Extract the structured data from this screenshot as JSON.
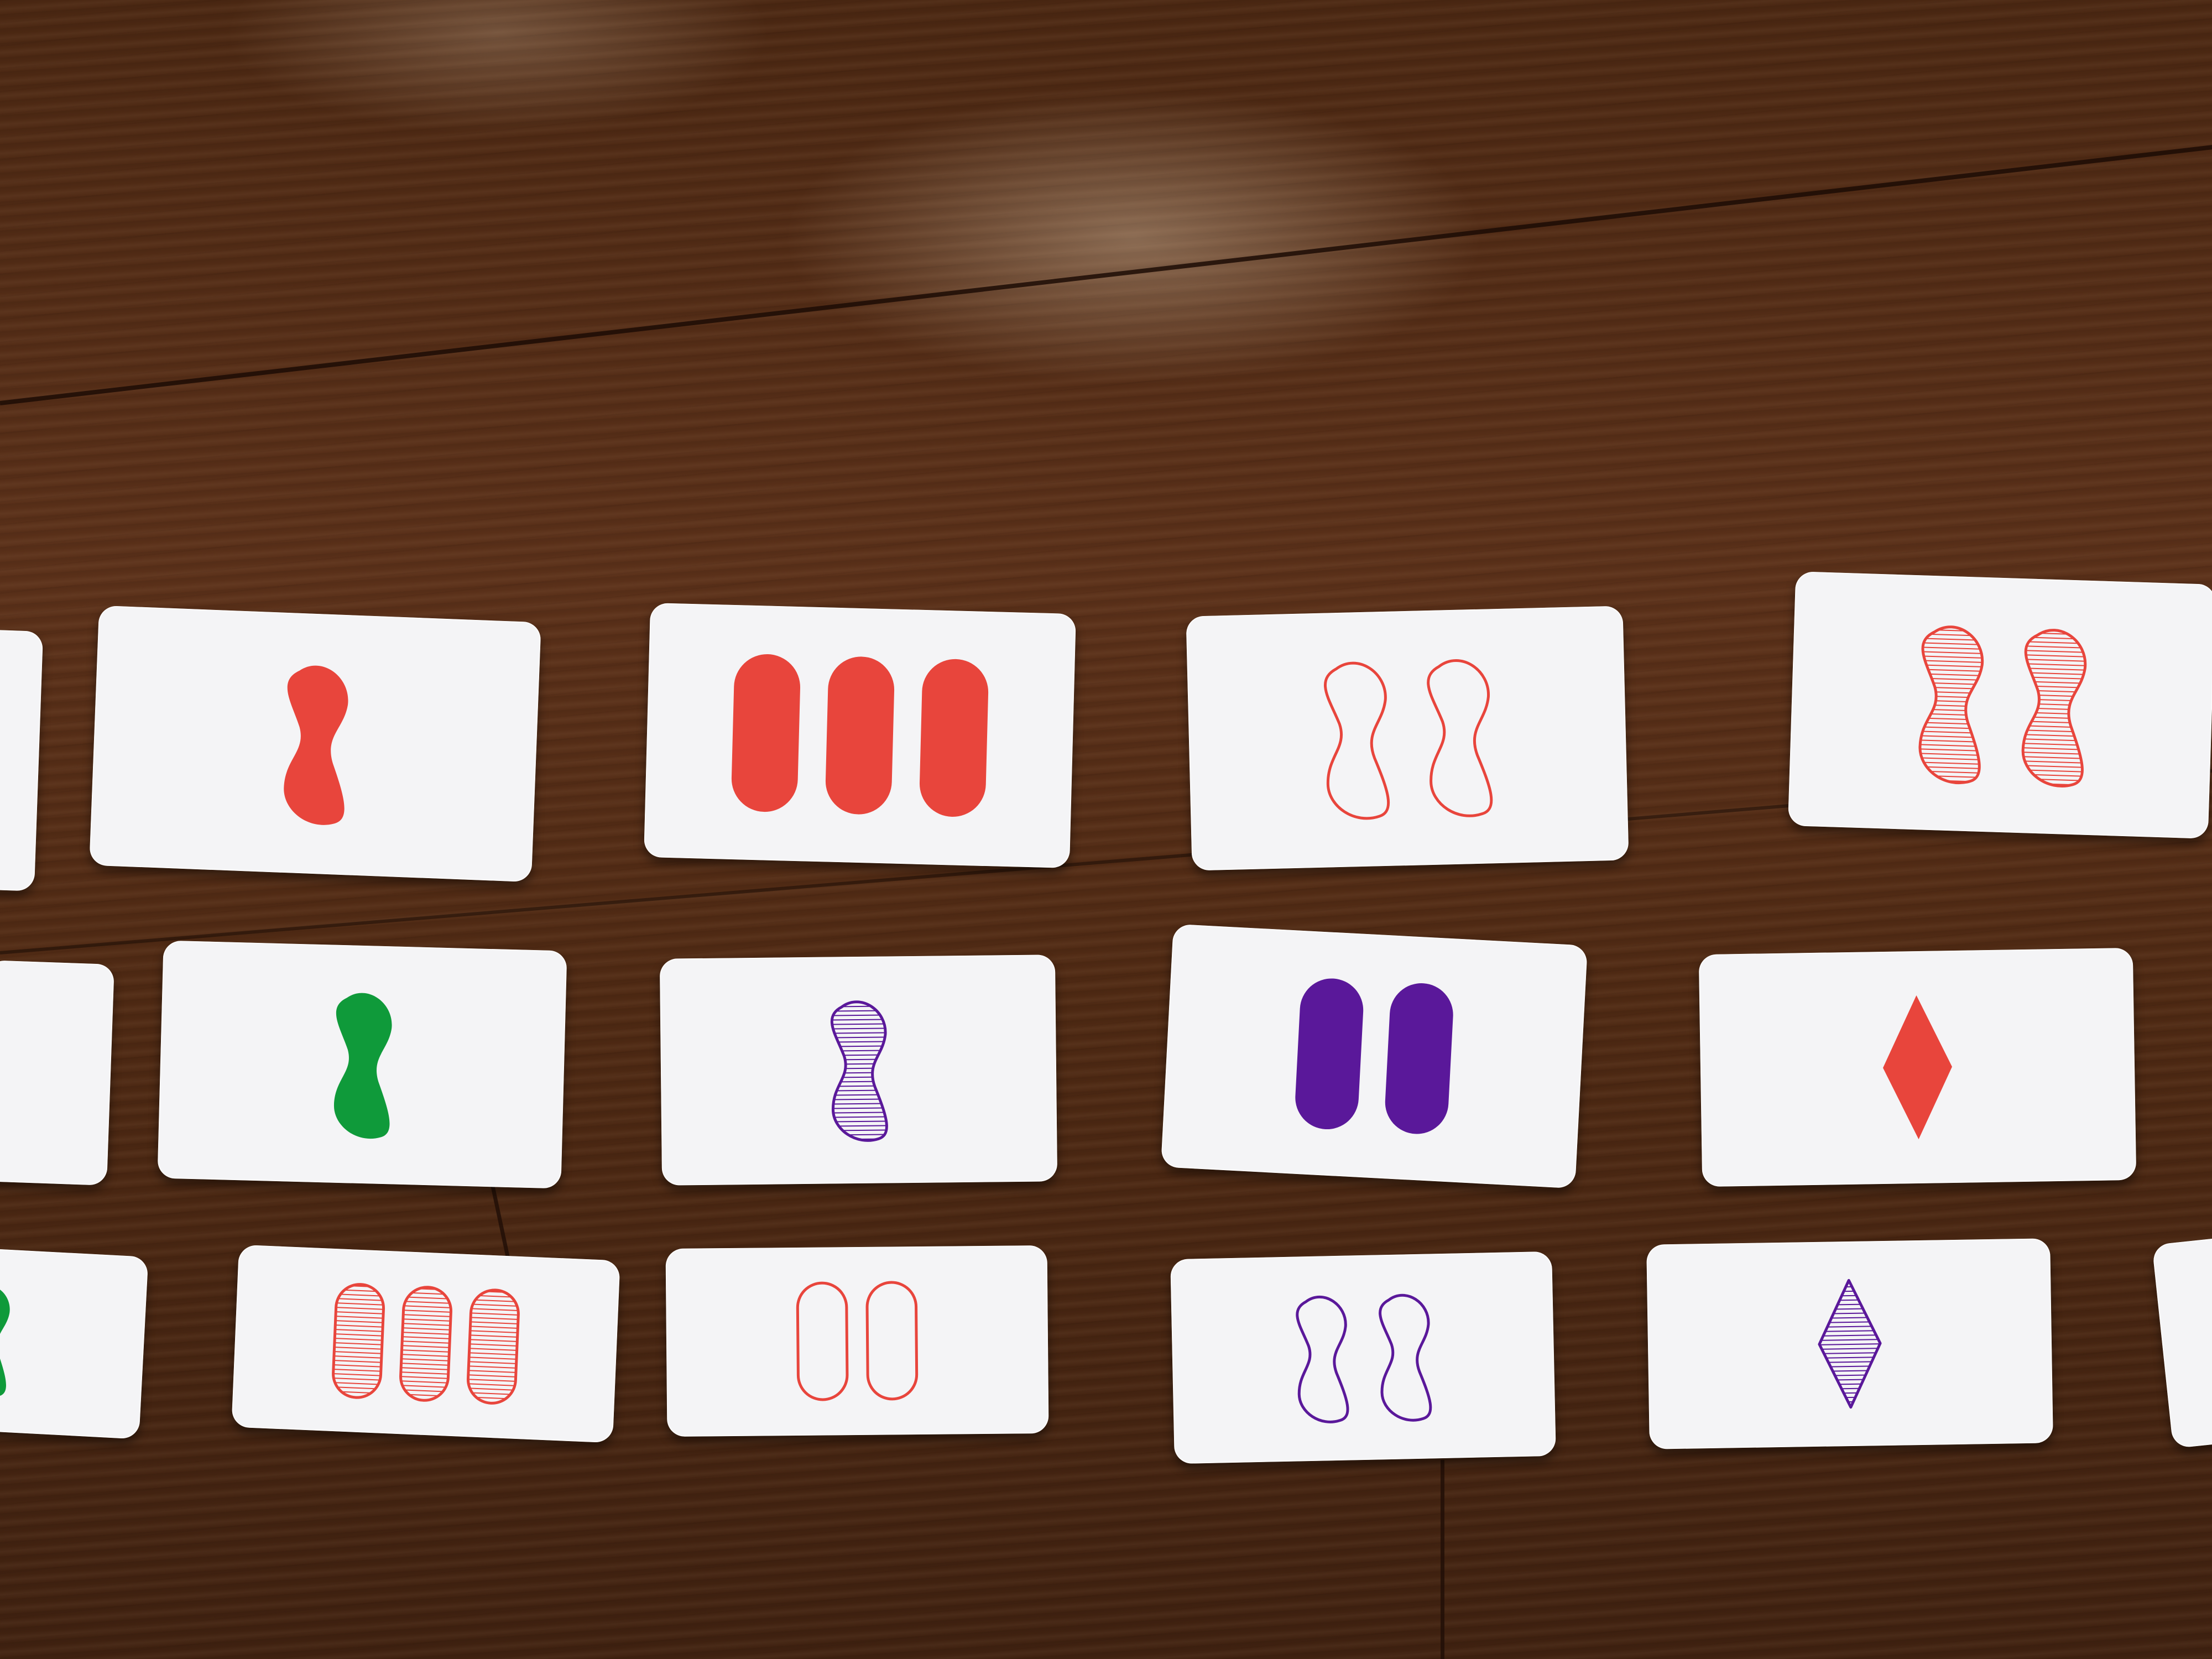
{
  "scene": {
    "description_tag": "set-card-game",
    "colors": {
      "red": "#e8453c",
      "green": "#0f9a3a",
      "purple": "#5a189a"
    },
    "cards": [
      {
        "row": 1,
        "col": 1,
        "count": 1,
        "shape": "squiggle",
        "fill": "solid",
        "color": "red"
      },
      {
        "row": 1,
        "col": 2,
        "count": 3,
        "shape": "oval",
        "fill": "solid",
        "color": "red"
      },
      {
        "row": 1,
        "col": 3,
        "count": 2,
        "shape": "squiggle",
        "fill": "empty",
        "color": "red"
      },
      {
        "row": 1,
        "col": 4,
        "count": 2,
        "shape": "squiggle",
        "fill": "striped",
        "color": "red"
      },
      {
        "row": 2,
        "col": 1,
        "count": 1,
        "shape": "squiggle",
        "fill": "solid",
        "color": "green"
      },
      {
        "row": 2,
        "col": 2,
        "count": 1,
        "shape": "squiggle",
        "fill": "striped",
        "color": "purple"
      },
      {
        "row": 2,
        "col": 3,
        "count": 2,
        "shape": "oval",
        "fill": "solid",
        "color": "purple"
      },
      {
        "row": 2,
        "col": 4,
        "count": 1,
        "shape": "diamond",
        "fill": "solid",
        "color": "red"
      },
      {
        "row": 3,
        "col": 1,
        "count": 3,
        "shape": "oval",
        "fill": "striped",
        "color": "red"
      },
      {
        "row": 3,
        "col": 2,
        "count": 2,
        "shape": "oval",
        "fill": "empty",
        "color": "red"
      },
      {
        "row": 3,
        "col": 3,
        "count": 2,
        "shape": "squiggle",
        "fill": "empty",
        "color": "purple"
      },
      {
        "row": 3,
        "col": 4,
        "count": 1,
        "shape": "diamond",
        "fill": "striped",
        "color": "purple"
      }
    ],
    "partial_cards": [
      {
        "side": "left",
        "row": 1
      },
      {
        "side": "left",
        "row": 2
      },
      {
        "side": "left",
        "row": 3,
        "count": 1,
        "shape": "squiggle",
        "fill": "solid",
        "color": "green"
      },
      {
        "side": "right",
        "row": 3
      }
    ]
  }
}
